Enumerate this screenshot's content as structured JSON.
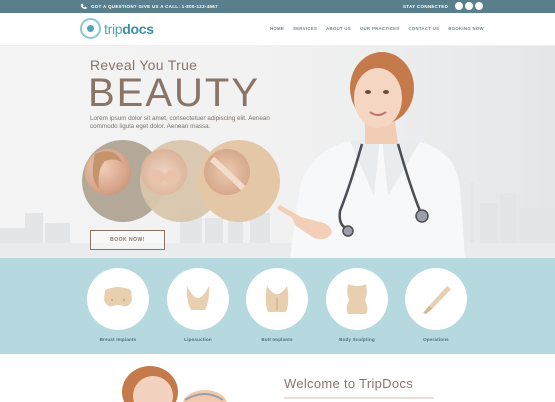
{
  "topbar": {
    "phone_text": "GOT A QUESTION? GIVE US A CALL: 1-800-123-4567",
    "stay_connected": "STAY CONNECTED",
    "social_icons": [
      "facebook-icon",
      "twitter-icon",
      "rss-icon"
    ]
  },
  "header": {
    "logo_prefix": "trip",
    "logo_suffix": "docs",
    "nav": [
      "HOME",
      "SERVICES",
      "ABOUT US",
      "OUR PRACTICES",
      "CONTACT US",
      "BOOKING NOW"
    ]
  },
  "hero": {
    "reveal": "Reveal You True",
    "beauty": "BEAUTY",
    "lorem": "Lorem ipsum dolor sit amet, consectetuer adipiscing elit. Aenean commodo ligula eget dolor. Aenean massa.",
    "book_now": "BOOK NOW!"
  },
  "services": [
    {
      "label": "Breast Implants",
      "icon": "breast-icon"
    },
    {
      "label": "Liposuction",
      "icon": "hips-icon"
    },
    {
      "label": "Butt Implants",
      "icon": "butt-icon"
    },
    {
      "label": "Body Sculpting",
      "icon": "torso-icon"
    },
    {
      "label": "Operations",
      "icon": "scalpel-icon"
    }
  ],
  "welcome": {
    "title": "Welcome to TripDocs"
  },
  "colors": {
    "topbar": "#5a7f8c",
    "accent": "#4fa4b7",
    "brown": "#8a7466",
    "services_bg": "#b6d8df",
    "icon_fill": "#e8cfb0"
  }
}
